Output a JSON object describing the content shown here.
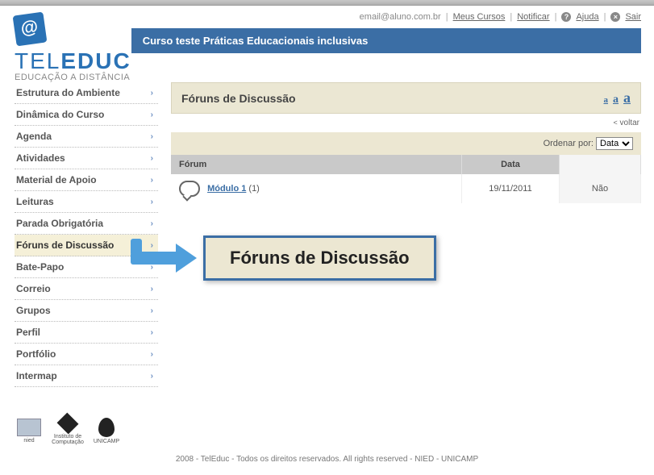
{
  "brand": {
    "name_part1": "TEL",
    "name_part2": "EDUC",
    "tagline": "EDUCAÇÃO A DISTÂNCIA"
  },
  "utility": {
    "email": "email@aluno.com.br",
    "my_courses": "Meus Cursos",
    "notify": "Notificar",
    "help": "Ajuda",
    "exit": "Sair"
  },
  "course_title": "Curso teste Práticas Educacionais inclusivas",
  "nav": [
    {
      "label": "Estrutura do Ambiente"
    },
    {
      "label": "Dinâmica do Curso"
    },
    {
      "label": "Agenda"
    },
    {
      "label": "Atividades"
    },
    {
      "label": "Material de Apoio"
    },
    {
      "label": "Leituras"
    },
    {
      "label": "Parada Obrigatória"
    },
    {
      "label": "Fóruns de Discussão",
      "active": true
    },
    {
      "label": "Bate-Papo"
    },
    {
      "label": "Correio"
    },
    {
      "label": "Grupos"
    },
    {
      "label": "Perfil"
    },
    {
      "label": "Portfólio"
    },
    {
      "label": "Intermap"
    }
  ],
  "section": {
    "title": "Fóruns de Discussão",
    "back": "voltar"
  },
  "sort": {
    "label": "Ordenar por:",
    "options": [
      "Data"
    ],
    "selected": "Data"
  },
  "table": {
    "cols": {
      "forum": "Fórum",
      "date": "Data",
      "extra": ""
    },
    "rows": [
      {
        "title": "Módulo 1",
        "count": "(1)",
        "date": "19/11/2011",
        "extra": "Não"
      }
    ]
  },
  "callout": "Fóruns de Discussão",
  "footer_logos": [
    "nied",
    "Instituto de Computação",
    "UNICAMP"
  ],
  "footer": "2008 - TelEduc - Todos os direitos reservados. All rights reserved - NIED - UNICAMP"
}
